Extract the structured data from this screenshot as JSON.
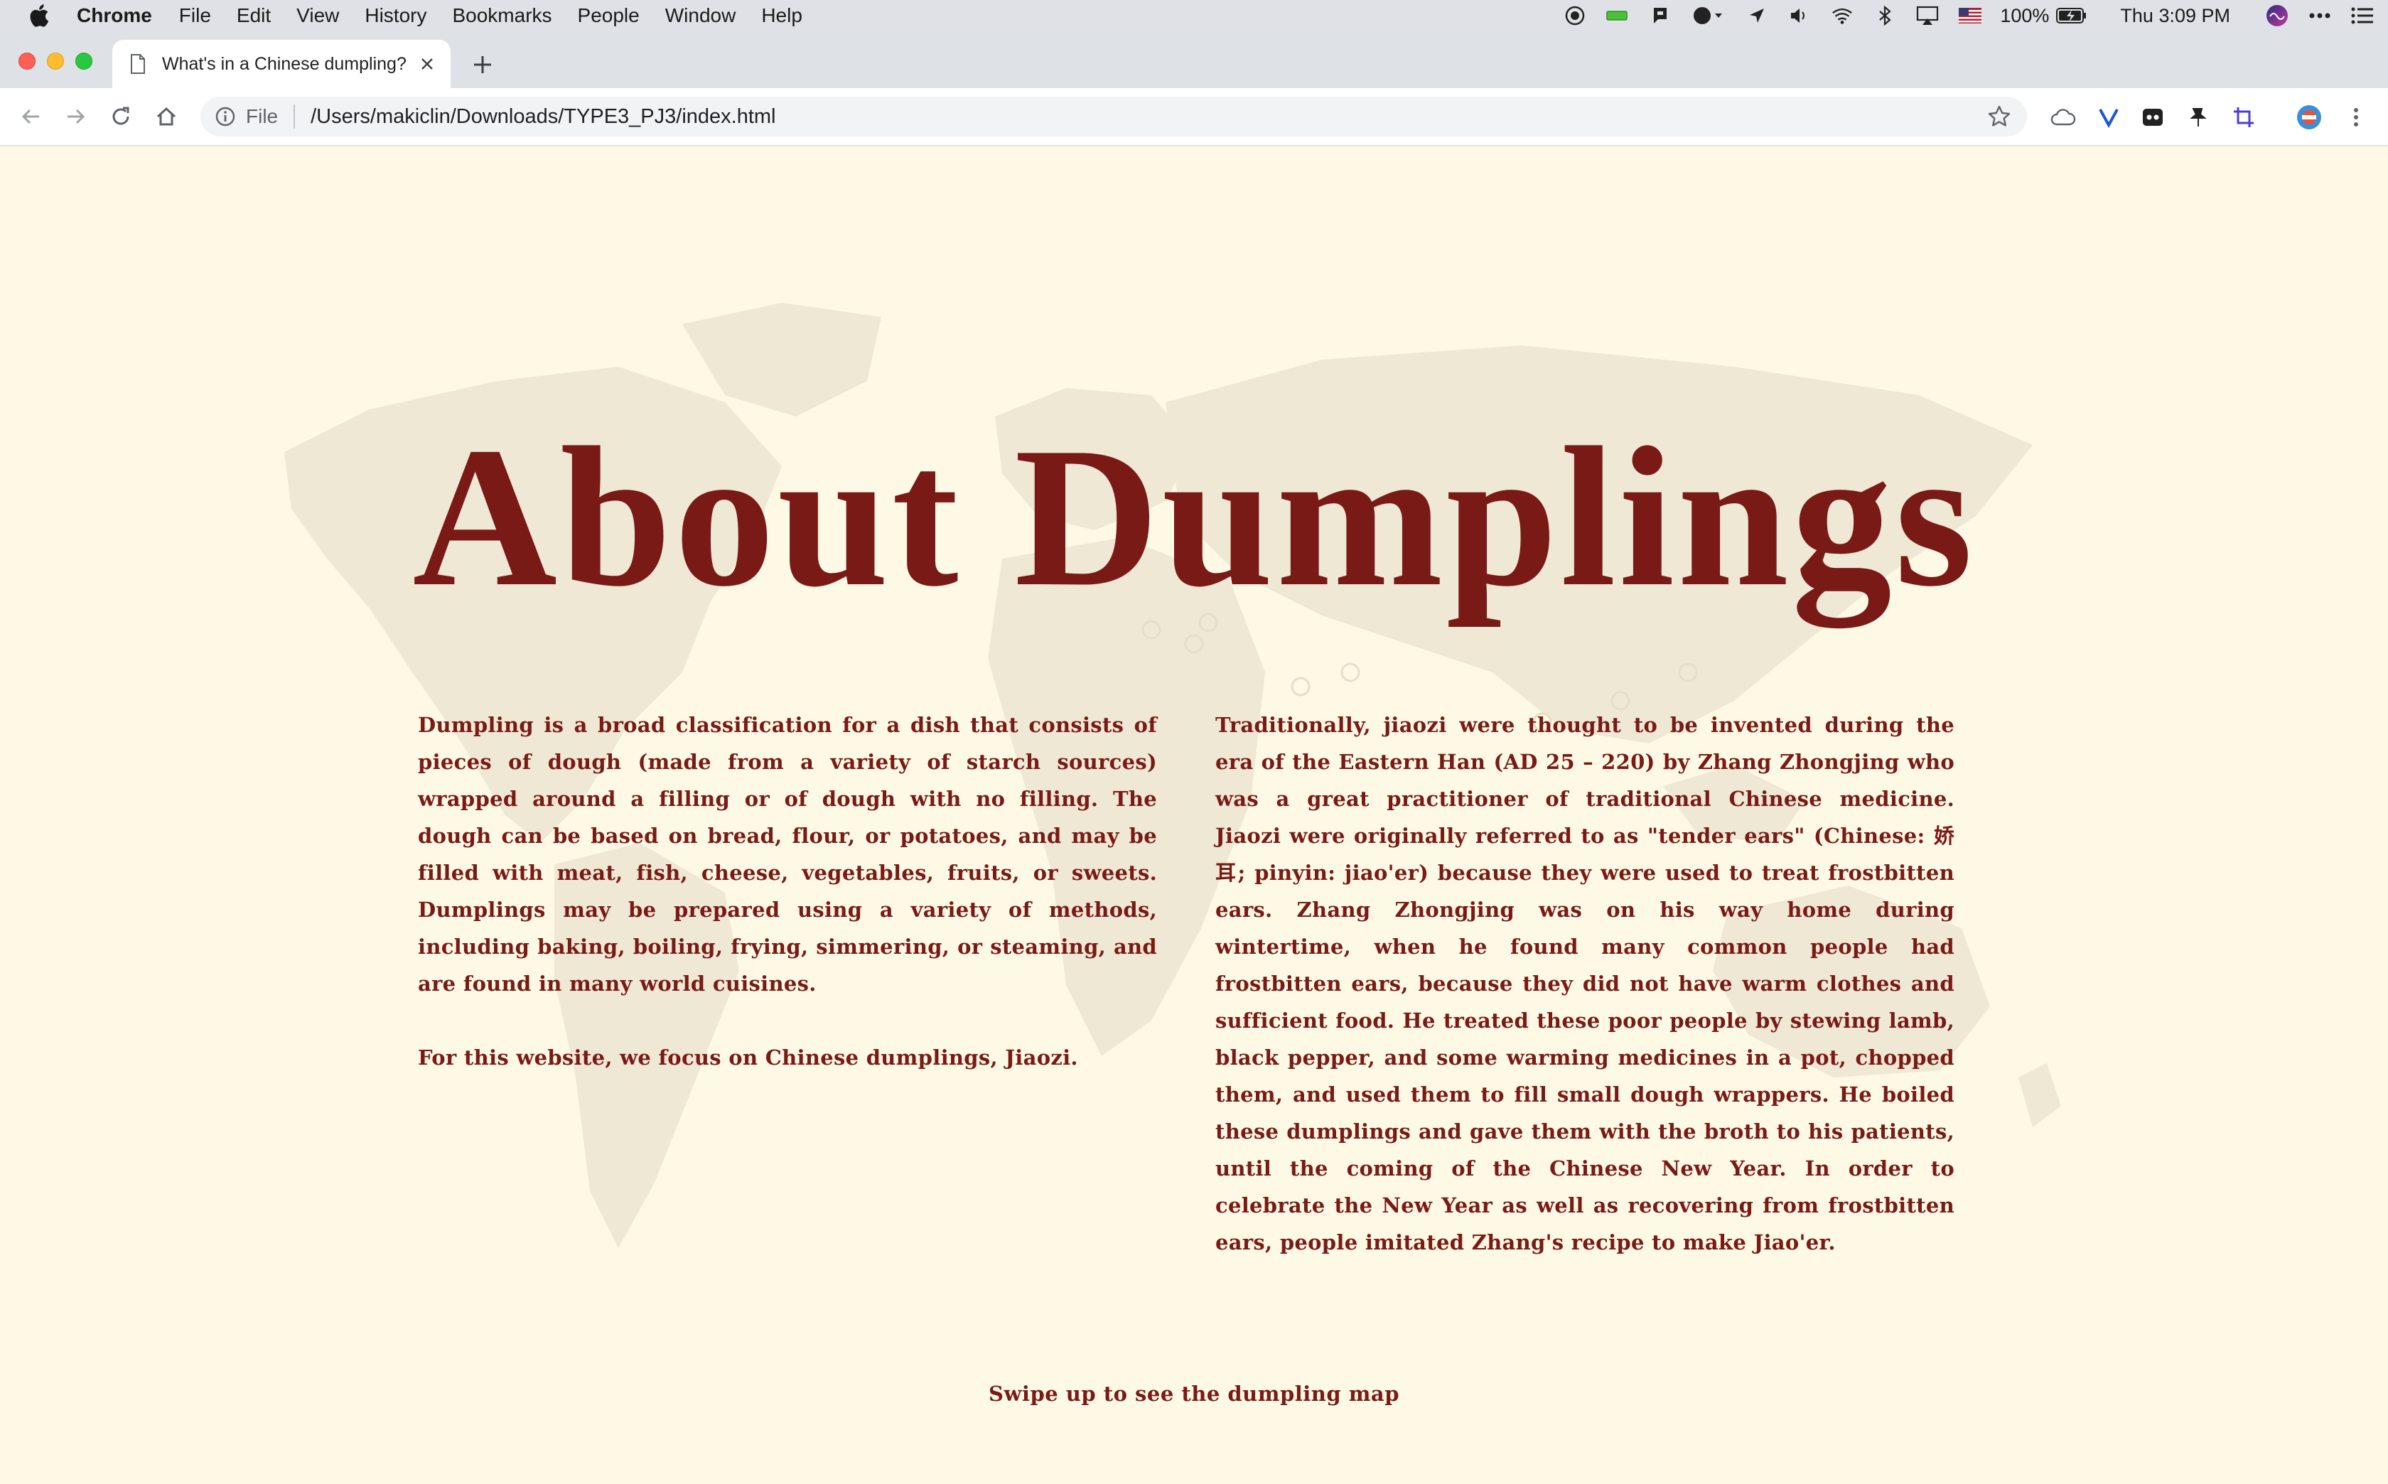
{
  "menubar": {
    "app_name": "Chrome",
    "menus": [
      "File",
      "Edit",
      "View",
      "History",
      "Bookmarks",
      "People",
      "Window",
      "Help"
    ],
    "battery": "100%",
    "clock": "Thu 3:09 PM"
  },
  "browser": {
    "tab_title": "What's in a Chinese dumpling?",
    "scheme_label": "File",
    "url": "/Users/makiclin/Downloads/TYPE3_PJ3/index.html"
  },
  "page": {
    "title": "About Dumplings",
    "left_paragraphs": [
      "Dumpling is a broad classification for a dish that consists of pieces of dough (made from a variety of starch sources) wrapped around a filling or of dough with no filling. The dough can be based on bread, flour, or potatoes, and may be filled with meat, fish, cheese, vegetables, fruits, or sweets. Dumplings may be prepared using a variety of methods, including baking, boiling, frying, simmering, or steaming, and are found in many world cuisines.",
      "For this website, we focus on Chinese dumplings, Jiaozi."
    ],
    "right_paragraph": "Traditionally, jiaozi were thought to be invented during the era of the Eastern Han (AD 25 – 220) by Zhang Zhongjing who was a great practitioner of traditional Chinese medicine. Jiaozi were originally referred to as \"tender ears\" (Chinese: 娇耳; pinyin: jiao'er) because they were used to treat frostbitten ears. Zhang Zhongjing was on his way home during wintertime, when he found many common people had frostbitten ears, because they did not have warm clothes and sufficient food. He treated these poor people by stewing lamb, black pepper, and some warming medicines in a pot, chopped them, and used them to fill small dough wrappers. He boiled these dumplings and gave them with the broth to his patients, until the coming of the Chinese New Year. In order to celebrate the New Year as well as recovering from frostbitten ears, people imitated Zhang's recipe to make Jiao'er.",
    "swipe_hint": "Swipe up to see the dumpling map"
  },
  "colors": {
    "accent": "#7a1a16",
    "page_background": "#fdf9e4",
    "map_tint": "#ece6d2"
  }
}
